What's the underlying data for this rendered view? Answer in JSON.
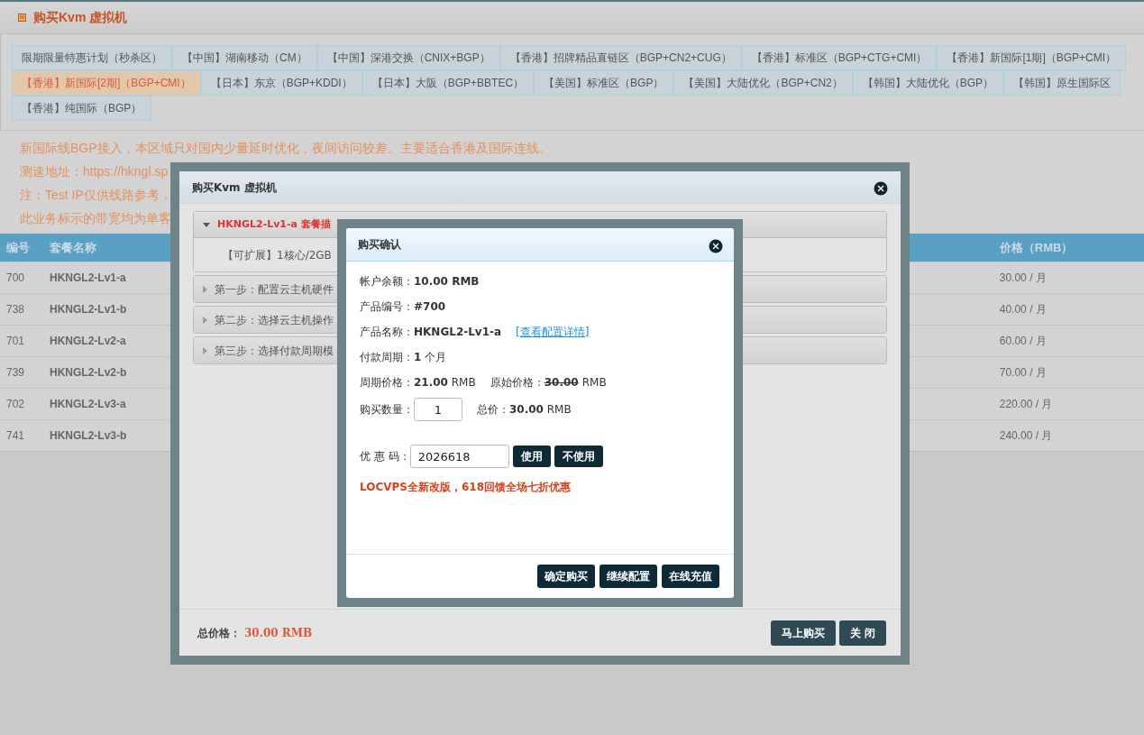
{
  "page_title": "购买Kvm 虚拟机",
  "tab_rows": [
    [
      {
        "label": "限期限量特惠计划（秒杀区）",
        "selected": false
      },
      {
        "label": "【中国】湖南移动（CM）",
        "selected": false
      },
      {
        "label": "【中国】深港交换（CNIX+BGP）",
        "selected": false
      },
      {
        "label": "【香港】招牌精品直链区（BGP+CN2+CUG）",
        "selected": false
      },
      {
        "label": "【香港】标准区（BGP+CTG+CMI）",
        "selected": false
      },
      {
        "label": "【香港】新国际[1期]（BGP+CMI）",
        "selected": false
      }
    ],
    [
      {
        "label": "【香港】新国际[2期]（BGP+CMI）",
        "selected": true
      },
      {
        "label": "【日本】东京（BGP+KDDI）",
        "selected": false
      },
      {
        "label": "【日本】大阪（BGP+BBTEC）",
        "selected": false
      },
      {
        "label": "【美国】标准区（BGP）",
        "selected": false
      },
      {
        "label": "【美国】大陆优化（BGP+CN2）",
        "selected": false
      },
      {
        "label": "【韩国】大陆优化（BGP）",
        "selected": false
      },
      {
        "label": "【韩国】原生国际区",
        "selected": false
      }
    ],
    [
      {
        "label": "【香港】纯国际（BGP）",
        "selected": false
      }
    ]
  ],
  "notes": [
    "新国际线BGP接入，本区域只对国内少量延时优化，夜间访问较差。主要适合香港及国际连线。",
    "测速地址：https://hkngl.sp",
    "注：Test IP仅供线路参考，",
    "此业务标示的带宽均为单客"
  ],
  "table": {
    "columns": [
      "编号",
      "套餐名称",
      "价格（RMB）"
    ],
    "rows": [
      [
        "700",
        "HKNGL2-Lv1-a",
        "30.00 / 月"
      ],
      [
        "738",
        "HKNGL2-Lv1-b",
        "40.00 / 月"
      ],
      [
        "701",
        "HKNGL2-Lv2-a",
        "60.00 / 月"
      ],
      [
        "739",
        "HKNGL2-Lv2-b",
        "70.00 / 月"
      ],
      [
        "702",
        "HKNGL2-Lv3-a",
        "220.00 / 月"
      ],
      [
        "741",
        "HKNGL2-Lv3-b",
        "240.00 / 月"
      ]
    ]
  },
  "modal": {
    "title": "购买Kvm 虚拟机",
    "panels": [
      {
        "title": "HKNGL2-Lv1-a 套餐描",
        "expanded": true,
        "body": "【可扩展】1核心/2GB"
      },
      {
        "title": "第一步：配置云主机硬件",
        "expanded": false
      },
      {
        "title": "第二步：选择云主机操作",
        "expanded": false
      },
      {
        "title": "第三步：选择付款周期模",
        "expanded": false
      }
    ],
    "total_label": "总价格：",
    "total_value": "30.00 RMB",
    "buttons": [
      "马上购买",
      "关 闭"
    ]
  },
  "confirm": {
    "title": "购买确认",
    "rows": [
      {
        "kind": "text",
        "label": "帐户余额：",
        "value": "**10.00 RMB**"
      },
      {
        "kind": "text",
        "label": "产品编号：",
        "value": "**#700**"
      },
      {
        "kind": "link",
        "label": "产品名称：",
        "value": "**HKNGL2-Lv1-a**",
        "link": "[查看配置详情]"
      },
      {
        "kind": "text",
        "label": "付款周期：",
        "value": "**1** 个月"
      },
      {
        "kind": "price",
        "label": "周期价格：",
        "value": "**21.00** RMB",
        "label2": "原始价格：",
        "original": "30.00",
        "unit": "RMB"
      },
      {
        "kind": "quantity",
        "label": "购买数量：",
        "input": "1",
        "label2": "总价：",
        "value": "**30.00** RMB"
      },
      {
        "kind": "coupon",
        "label": "优 惠 码：",
        "input": "2026618",
        "buttons": [
          "使用",
          "不使用"
        ]
      },
      {
        "kind": "promo",
        "value": "LOCVPS全新改版，618回馈全场七折优惠"
      }
    ],
    "buttons": [
      "确定购买",
      "继续配置",
      "在线充值"
    ]
  }
}
